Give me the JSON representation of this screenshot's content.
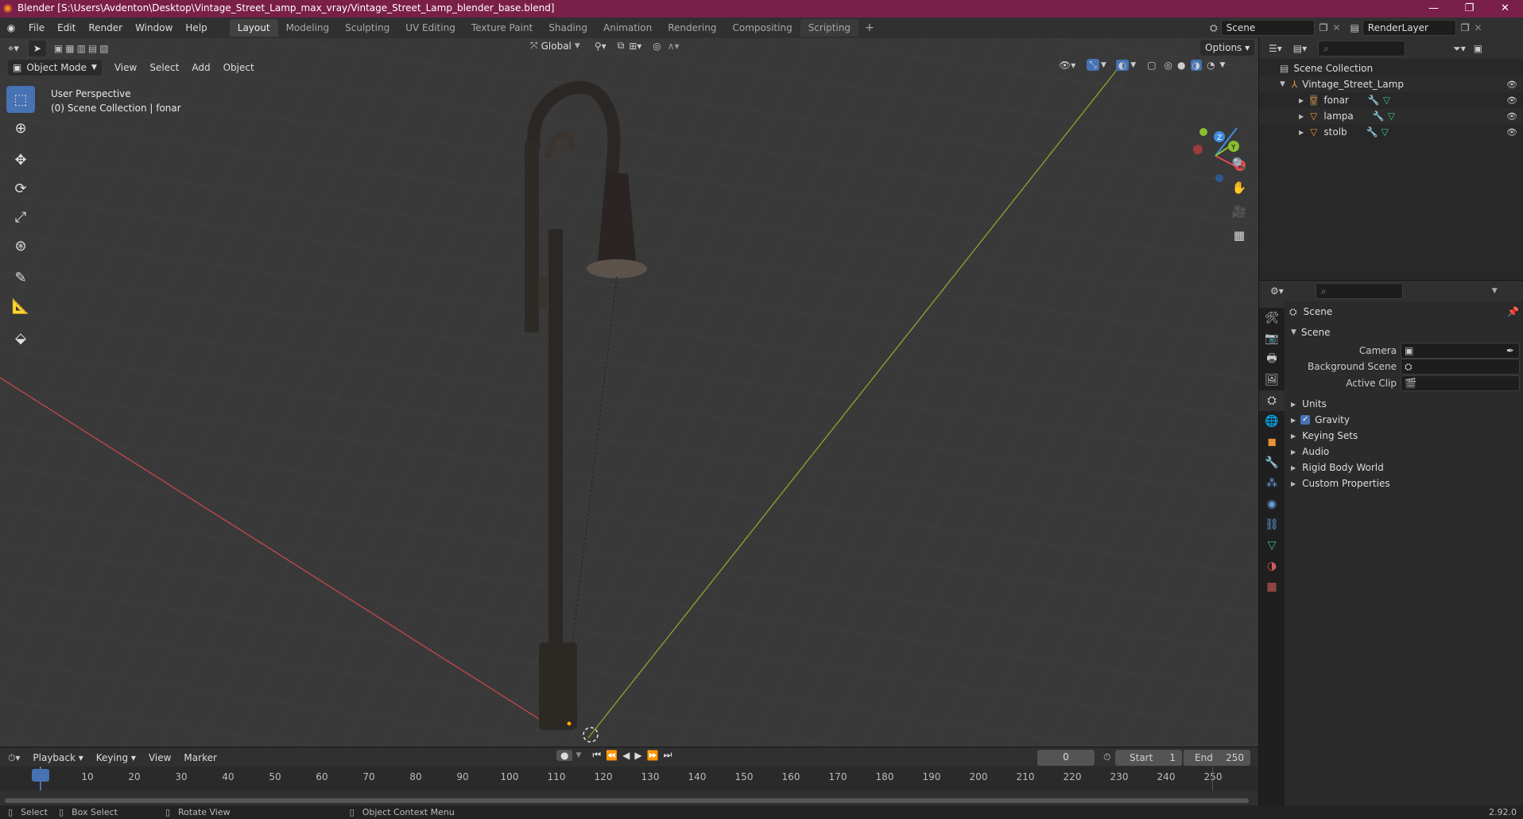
{
  "titlebar": {
    "title": "Blender [S:\\Users\\Avdenton\\Desktop\\Vintage_Street_Lamp_max_vray/Vintage_Street_Lamp_blender_base.blend]",
    "min": "—",
    "max": "❐",
    "close": "✕"
  },
  "menu": [
    "File",
    "Edit",
    "Render",
    "Window",
    "Help"
  ],
  "workspaces": [
    "Layout",
    "Modeling",
    "Sculpting",
    "UV Editing",
    "Texture Paint",
    "Shading",
    "Animation",
    "Rendering",
    "Compositing",
    "Scripting"
  ],
  "scene_field": "Scene",
  "renderlayer_field": "RenderLayer",
  "viewport": {
    "mode": "Object Mode",
    "menus": [
      "View",
      "Select",
      "Add",
      "Object"
    ],
    "orientation": "Global",
    "options": "Options",
    "overlay_title": "User Perspective",
    "overlay_sub": "(0) Scene Collection | fonar"
  },
  "outliner": {
    "root": "Scene Collection",
    "collection": "Vintage_Street_Lamp",
    "objects": [
      "fonar",
      "lampa",
      "stolb"
    ]
  },
  "properties": {
    "header": "Scene",
    "section": "Scene",
    "fields": [
      {
        "label": "Camera"
      },
      {
        "label": "Background Scene"
      },
      {
        "label": "Active Clip"
      }
    ],
    "subpanels": [
      "Units",
      "Gravity",
      "Keying Sets",
      "Audio",
      "Rigid Body World",
      "Custom Properties"
    ],
    "gravity_checked": true
  },
  "timeline": {
    "menus": [
      "Playback",
      "Keying",
      "View",
      "Marker"
    ],
    "current_frame": "0",
    "start_label": "Start",
    "start": "1",
    "end_label": "End",
    "end": "250",
    "ticks": [
      "0",
      "10",
      "20",
      "30",
      "40",
      "50",
      "60",
      "70",
      "80",
      "90",
      "100",
      "110",
      "120",
      "130",
      "140",
      "150",
      "160",
      "170",
      "180",
      "190",
      "200",
      "210",
      "220",
      "230",
      "240",
      "250"
    ]
  },
  "statusbar": {
    "select": "Select",
    "box_select": "Box Select",
    "rotate": "Rotate View",
    "context": "Object Context Menu",
    "version": "2.92.0"
  },
  "colors": {
    "accent": "#4772b3",
    "titlebar": "#7a1f48",
    "x_axis": "#e0494f",
    "y_axis": "#8bbf2f",
    "z_axis": "#3f8ce0"
  }
}
